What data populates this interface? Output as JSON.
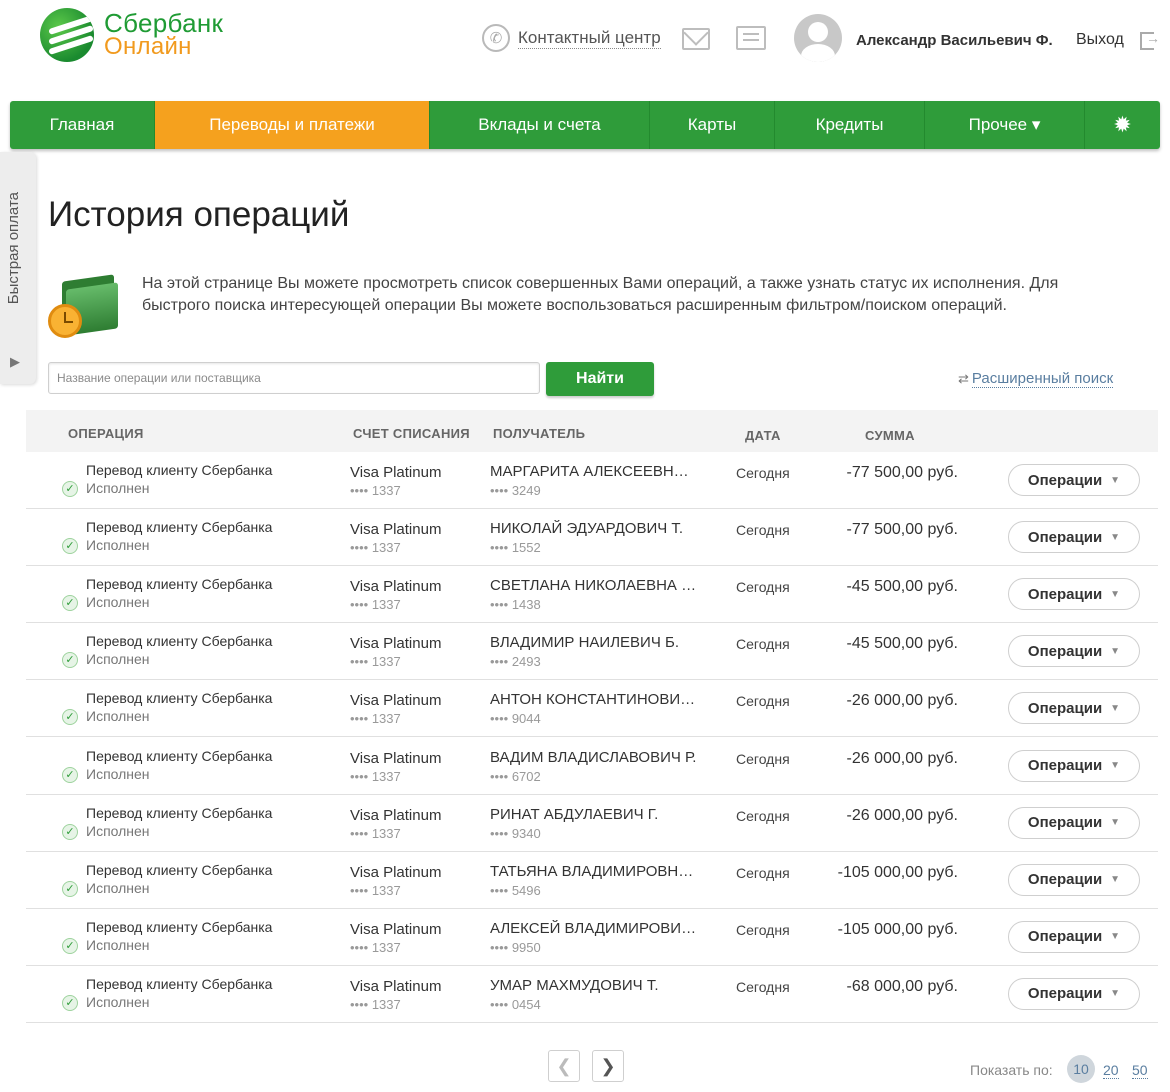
{
  "header": {
    "logo_line1": "Сбербанк",
    "logo_line2": "Онлайн",
    "contact_center": "Контактный центр",
    "user_name": "Александр Васильевич Ф.",
    "logout": "Выход"
  },
  "nav": {
    "items": [
      {
        "label": "Главная"
      },
      {
        "label": "Переводы и платежи",
        "active": true
      },
      {
        "label": "Вклады и счета"
      },
      {
        "label": "Карты"
      },
      {
        "label": "Кредиты"
      },
      {
        "label": "Прочее ▾"
      }
    ]
  },
  "sidebar": {
    "quick_pay": "Быстрая оплата"
  },
  "page": {
    "title": "История операций",
    "info": "На этой странице Вы можете просмотреть список совершенных Вами операций, а также узнать статус их исполнения. Для быстрого поиска интересующей операции Вы можете воспользоваться расширенным фильтром/поиском операций."
  },
  "search": {
    "placeholder": "Название операции или поставщика",
    "button": "Найти",
    "advanced": "Расширенный поиск"
  },
  "table": {
    "headers": {
      "operation": "ОПЕРАЦИЯ",
      "account": "СЧЕТ СПИСАНИЯ",
      "recipient": "ПОЛУЧАТЕЛЬ",
      "date": "ДАТА",
      "amount": "СУММА"
    },
    "rows": [
      {
        "op": "Перевод клиенту Сбербанка",
        "status": "Исполнен",
        "account": "Visa Platinum",
        "account_num": "•••• 1337",
        "recipient": "МАРГАРИТА АЛЕКСЕЕВН…",
        "recipient_num": "•••• 3249",
        "date": "Сегодня",
        "amount": "-77 500,00 руб.",
        "action": "Операции"
      },
      {
        "op": "Перевод клиенту Сбербанка",
        "status": "Исполнен",
        "account": "Visa Platinum",
        "account_num": "•••• 1337",
        "recipient": "НИКОЛАЙ ЭДУАРДОВИЧ Т.",
        "recipient_num": "•••• 1552",
        "date": "Сегодня",
        "amount": "-77 500,00 руб.",
        "action": "Операции"
      },
      {
        "op": "Перевод клиенту Сбербанка",
        "status": "Исполнен",
        "account": "Visa Platinum",
        "account_num": "•••• 1337",
        "recipient": "СВЕТЛАНА НИКОЛАЕВНА …",
        "recipient_num": "•••• 1438",
        "date": "Сегодня",
        "amount": "-45 500,00 руб.",
        "action": "Операции"
      },
      {
        "op": "Перевод клиенту Сбербанка",
        "status": "Исполнен",
        "account": "Visa Platinum",
        "account_num": "•••• 1337",
        "recipient": "ВЛАДИМИР НАИЛЕВИЧ Б.",
        "recipient_num": "•••• 2493",
        "date": "Сегодня",
        "amount": "-45 500,00 руб.",
        "action": "Операции"
      },
      {
        "op": "Перевод клиенту Сбербанка",
        "status": "Исполнен",
        "account": "Visa Platinum",
        "account_num": "•••• 1337",
        "recipient": "АНТОН КОНСТАНТИНОВИ…",
        "recipient_num": "•••• 9044",
        "date": "Сегодня",
        "amount": "-26 000,00 руб.",
        "action": "Операции"
      },
      {
        "op": "Перевод клиенту Сбербанка",
        "status": "Исполнен",
        "account": "Visa Platinum",
        "account_num": "•••• 1337",
        "recipient": "ВАДИМ ВЛАДИСЛАВОВИЧ Р.",
        "recipient_num": "•••• 6702",
        "date": "Сегодня",
        "amount": "-26 000,00 руб.",
        "action": "Операции"
      },
      {
        "op": "Перевод клиенту Сбербанка",
        "status": "Исполнен",
        "account": "Visa Platinum",
        "account_num": "•••• 1337",
        "recipient": "РИНАТ АБДУЛАЕВИЧ Г.",
        "recipient_num": "•••• 9340",
        "date": "Сегодня",
        "amount": "-26 000,00 руб.",
        "action": "Операции"
      },
      {
        "op": "Перевод клиенту Сбербанка",
        "status": "Исполнен",
        "account": "Visa Platinum",
        "account_num": "•••• 1337",
        "recipient": "ТАТЬЯНА ВЛАДИМИРОВН…",
        "recipient_num": "•••• 5496",
        "date": "Сегодня",
        "amount": "-105 000,00 руб.",
        "action": "Операции"
      },
      {
        "op": "Перевод клиенту Сбербанка",
        "status": "Исполнен",
        "account": "Visa Platinum",
        "account_num": "•••• 1337",
        "recipient": "АЛЕКСЕЙ ВЛАДИМИРОВИ…",
        "recipient_num": "•••• 9950",
        "date": "Сегодня",
        "amount": "-105 000,00 руб.",
        "action": "Операции"
      },
      {
        "op": "Перевод клиенту Сбербанка",
        "status": "Исполнен",
        "account": "Visa Platinum",
        "account_num": "•••• 1337",
        "recipient": "УМАР МАХМУДОВИЧ Т.",
        "recipient_num": "•••• 0454",
        "date": "Сегодня",
        "amount": "-68 000,00 руб.",
        "action": "Операции"
      }
    ]
  },
  "pagination": {
    "show_label": "Показать по:",
    "sizes": [
      "10",
      "20",
      "50"
    ],
    "active_size": "10"
  },
  "colors": {
    "brand_green": "#2f9c3a",
    "brand_orange": "#f5a11e",
    "link_blue": "#5a7ea0"
  }
}
